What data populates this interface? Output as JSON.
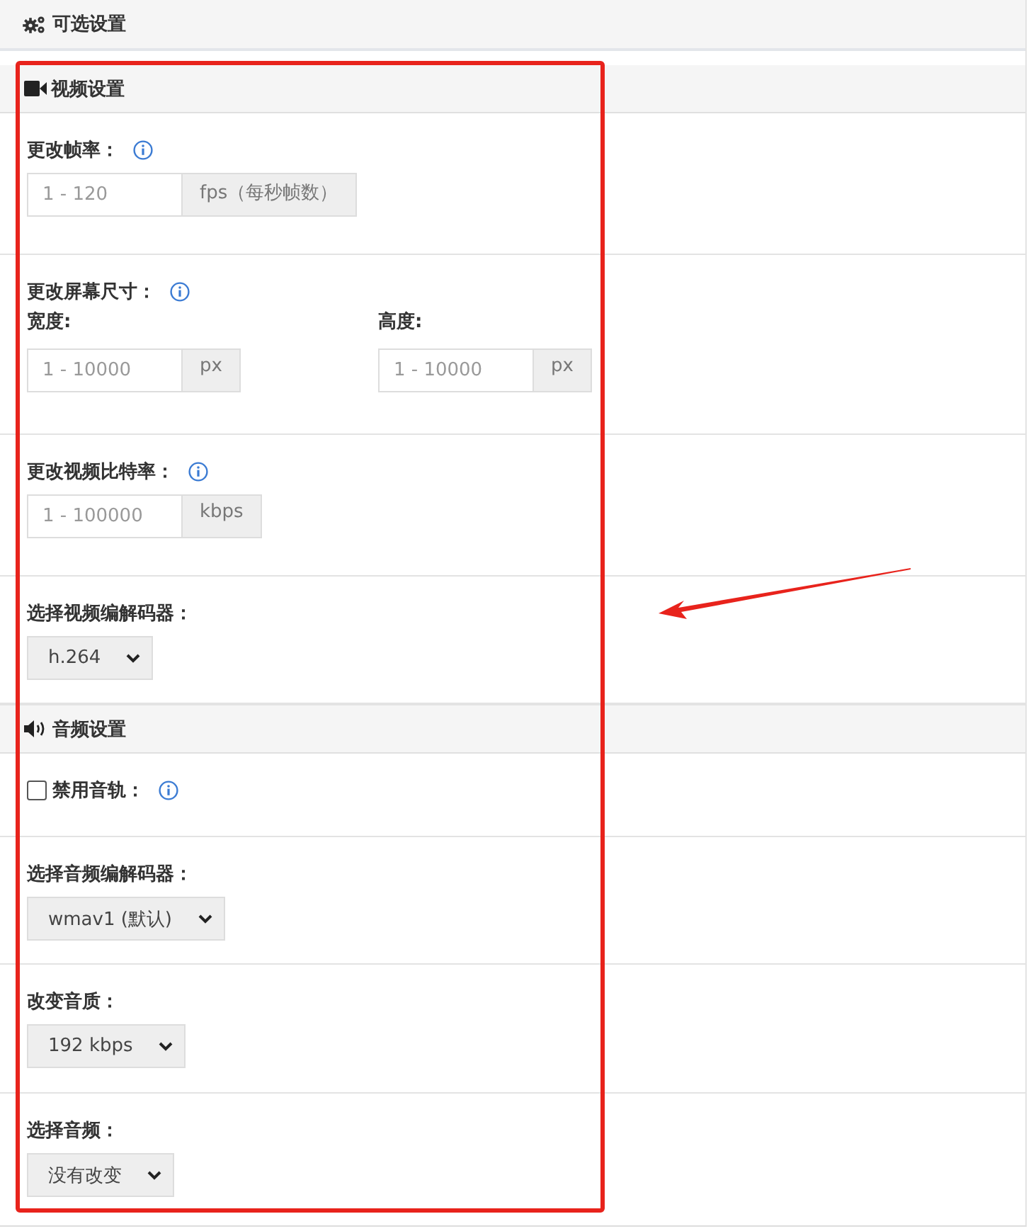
{
  "panel": {
    "title": "可选设置"
  },
  "sections": [
    {
      "kind": "video",
      "title": "视频设置",
      "rows": [
        {
          "kind": "input",
          "label": "更改帧率：",
          "info": true,
          "fields": [
            {
              "placeholder": "1 - 120",
              "unit": "fps（每秒帧数）"
            }
          ]
        },
        {
          "kind": "input",
          "label": "更改屏幕尺寸：",
          "info": true,
          "fields": [
            {
              "label": "宽度:",
              "placeholder": "1 - 10000",
              "unit": "px"
            },
            {
              "label": "高度:",
              "placeholder": "1 - 10000",
              "unit": "px"
            }
          ]
        },
        {
          "kind": "input",
          "label": "更改视频比特率：",
          "info": true,
          "fields": [
            {
              "placeholder": "1 - 100000",
              "unit": "kbps"
            }
          ]
        },
        {
          "kind": "select",
          "label": "选择视频编解码器：",
          "value": "h.264"
        }
      ]
    },
    {
      "kind": "audio",
      "title": "音频设置",
      "rows": [
        {
          "kind": "checkbox",
          "label": "禁用音轨：",
          "info": true,
          "checked": false
        },
        {
          "kind": "select",
          "label": "选择音频编解码器：",
          "value": "wmav1 (默认)"
        },
        {
          "kind": "select",
          "label": "改变音质：",
          "value": "192 kbps"
        },
        {
          "kind": "select",
          "label": "选择音频：",
          "value": "没有改变"
        }
      ]
    }
  ]
}
